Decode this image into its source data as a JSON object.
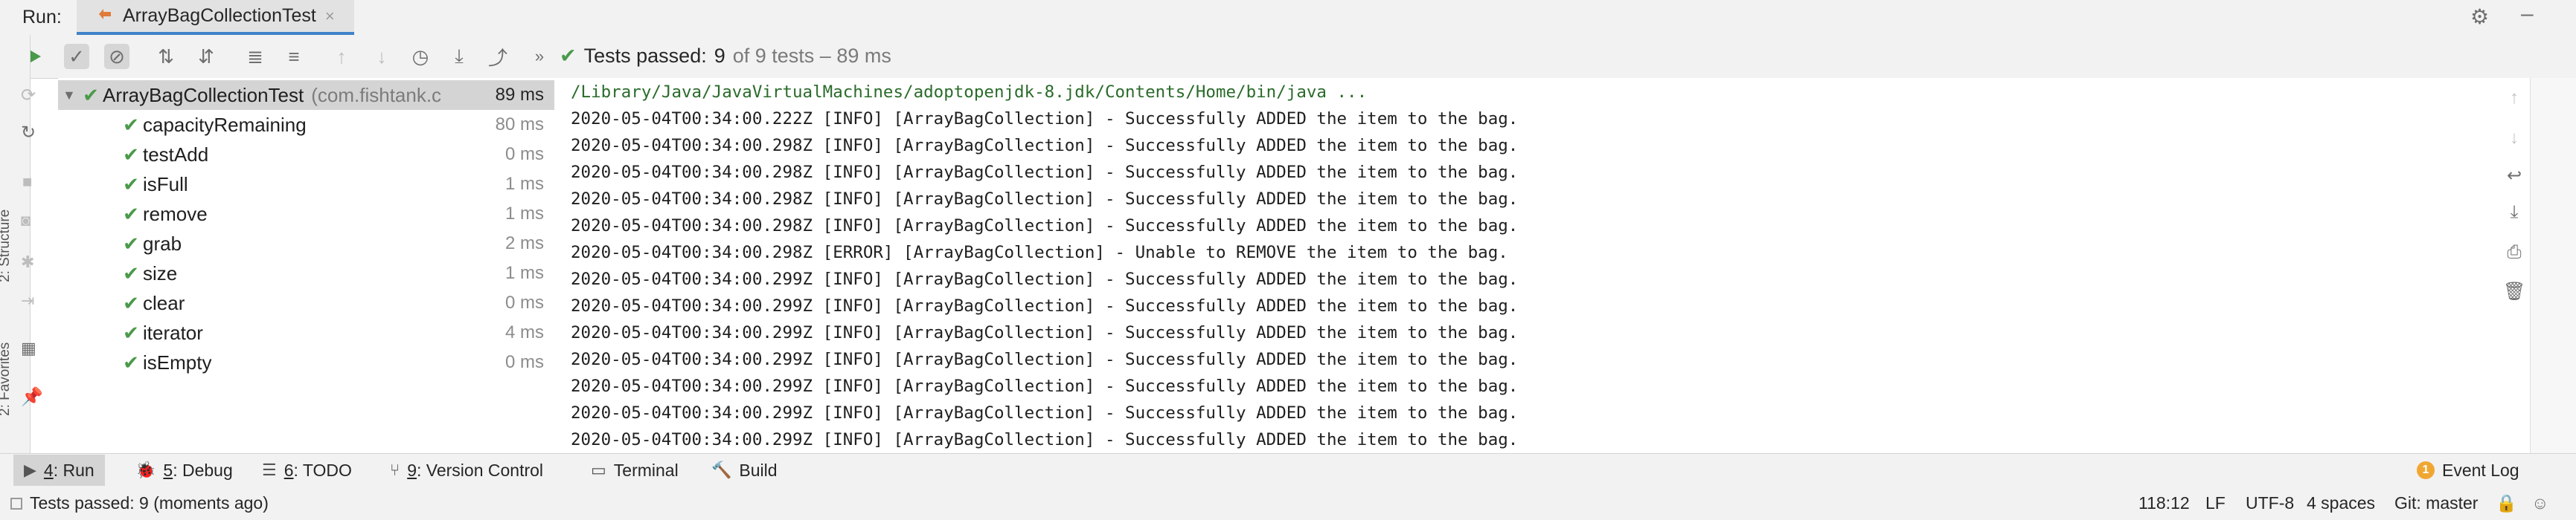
{
  "header": {
    "run_label": "Run:",
    "tab_title": "ArrayBagCollectionTest",
    "tab_close": "×"
  },
  "toolbar": {
    "icons": [
      "run-icon",
      "show-passed-icon",
      "show-ignored-icon",
      "sort-alphabetically-icon",
      "sort-by-duration-icon",
      "expand-all-icon",
      "collapse-all-icon",
      "previous-failed-icon",
      "next-failed-icon",
      "test-history-icon",
      "import-tests-icon",
      "export-tests-icon"
    ],
    "more": "»",
    "status": {
      "prefix": "Tests passed:",
      "count": "9",
      "suffix": "of 9 tests – 89 ms"
    }
  },
  "tree": {
    "root": {
      "name": "ArrayBagCollectionTest",
      "package": "(com.fishtank.c",
      "duration": "89 ms"
    },
    "tests": [
      {
        "name": "capacityRemaining",
        "duration": "80 ms"
      },
      {
        "name": "testAdd",
        "duration": "0 ms"
      },
      {
        "name": "isFull",
        "duration": "1 ms"
      },
      {
        "name": "remove",
        "duration": "1 ms"
      },
      {
        "name": "grab",
        "duration": "2 ms"
      },
      {
        "name": "size",
        "duration": "1 ms"
      },
      {
        "name": "clear",
        "duration": "0 ms"
      },
      {
        "name": "iterator",
        "duration": "4 ms"
      },
      {
        "name": "isEmpty",
        "duration": "0 ms"
      }
    ]
  },
  "console": {
    "command": "/Library/Java/JavaVirtualMachines/adoptopenjdk-8.jdk/Contents/Home/bin/java ...",
    "lines": [
      "2020-05-04T00:34:00.222Z [INFO] [ArrayBagCollection] - Successfully ADDED the item to the bag.",
      "2020-05-04T00:34:00.298Z [INFO] [ArrayBagCollection] - Successfully ADDED the item to the bag.",
      "2020-05-04T00:34:00.298Z [INFO] [ArrayBagCollection] - Successfully ADDED the item to the bag.",
      "2020-05-04T00:34:00.298Z [INFO] [ArrayBagCollection] - Successfully ADDED the item to the bag.",
      "2020-05-04T00:34:00.298Z [INFO] [ArrayBagCollection] - Successfully ADDED the item to the bag.",
      "2020-05-04T00:34:00.298Z [ERROR] [ArrayBagCollection] - Unable to REMOVE the item to the bag.",
      "2020-05-04T00:34:00.299Z [INFO] [ArrayBagCollection] - Successfully ADDED the item to the bag.",
      "2020-05-04T00:34:00.299Z [INFO] [ArrayBagCollection] - Successfully ADDED the item to the bag.",
      "2020-05-04T00:34:00.299Z [INFO] [ArrayBagCollection] - Successfully ADDED the item to the bag.",
      "2020-05-04T00:34:00.299Z [INFO] [ArrayBagCollection] - Successfully ADDED the item to the bag.",
      "2020-05-04T00:34:00.299Z [INFO] [ArrayBagCollection] - Successfully ADDED the item to the bag.",
      "2020-05-04T00:34:00.299Z [INFO] [ArrayBagCollection] - Successfully ADDED the item to the bag.",
      "2020-05-04T00:34:00.299Z [INFO] [ArrayBagCollection] - Successfully ADDED the item to the bag."
    ]
  },
  "side_labels": {
    "structure": "2: Structure",
    "favorites": "2: Favorites"
  },
  "bottom_tabs": [
    {
      "key": "4",
      "label": ": Run"
    },
    {
      "key": "5",
      "label": ": Debug"
    },
    {
      "key": "6",
      "label": ": TODO"
    },
    {
      "key": "9",
      "label": ": Version Control"
    },
    {
      "key": "",
      "label": "Terminal"
    },
    {
      "key": "",
      "label": "Build"
    }
  ],
  "event_log": {
    "badge": "1",
    "label": "Event Log"
  },
  "status_bar": {
    "message": "Tests passed: 9 (moments ago)",
    "position": "118:12",
    "line_separator": "LF",
    "encoding": "UTF-8",
    "indent": "4 spaces",
    "vcs": "Git: master"
  },
  "colors": {
    "pass_green": "#4a9a4a",
    "path_green": "#2a6b2a",
    "accent_blue": "#4083c9",
    "event_badge": "#f0a732"
  }
}
